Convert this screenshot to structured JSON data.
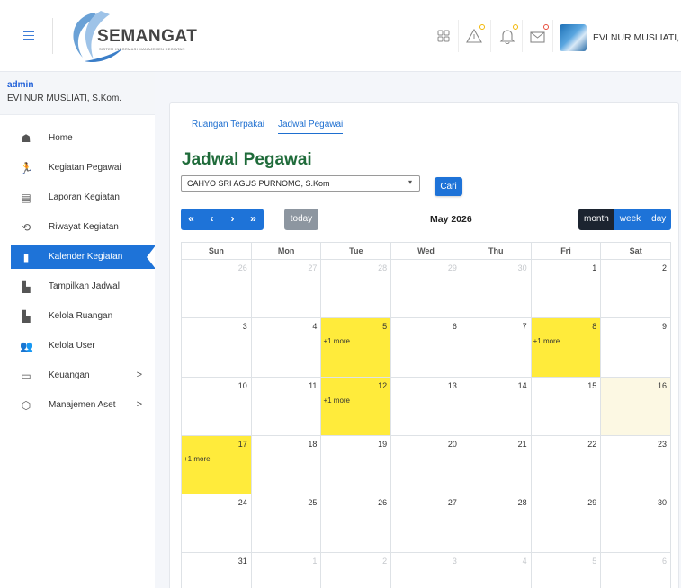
{
  "header": {
    "logo_title": "SEMANGAT",
    "logo_subtitle": "SISTEM INFORMASI MANAJEMEN KEGIATAN",
    "user_name": "EVI NUR MUSLIATI, S.Kor",
    "icons": [
      "grid-icon",
      "warning-icon",
      "bell-icon",
      "mail-icon"
    ]
  },
  "sidebar": {
    "role": "admin",
    "name": "EVI NUR MUSLIATI, S.Kom.",
    "items": [
      {
        "label": "Home",
        "icon": "house-icon"
      },
      {
        "label": "Kegiatan Pegawai",
        "icon": "person-run-icon"
      },
      {
        "label": "Laporan Kegiatan",
        "icon": "report-icon"
      },
      {
        "label": "Riwayat Kegiatan",
        "icon": "history-icon"
      },
      {
        "label": "Kalender Kegiatan",
        "icon": "calendar-book-icon",
        "active": true
      },
      {
        "label": "Tampilkan Jadwal",
        "icon": "building-icon"
      },
      {
        "label": "Kelola Ruangan",
        "icon": "building-icon"
      },
      {
        "label": "Kelola User",
        "icon": "users-icon"
      },
      {
        "label": "Keuangan",
        "icon": "table-icon",
        "chevron": ">"
      },
      {
        "label": "Manajemen Aset",
        "icon": "box-icon",
        "chevron": ">"
      }
    ]
  },
  "main": {
    "tabs": [
      {
        "label": "Ruangan Terpakai"
      },
      {
        "label": "Jadwal Pegawai",
        "active": true
      }
    ],
    "title": "Jadwal Pegawai",
    "select_value": "CAHYO SRI AGUS PURNOMO, S.Kom",
    "search_label": "Cari",
    "nav": {
      "first": "«",
      "prev": "‹",
      "next": "›",
      "last": "»"
    },
    "today_label": "today",
    "calendar_title": "May 2026",
    "views": [
      "month",
      "week",
      "day"
    ],
    "weekdays": [
      "Sun",
      "Mon",
      "Tue",
      "Wed",
      "Thu",
      "Fri",
      "Sat"
    ],
    "weeks": [
      [
        {
          "d": "26",
          "o": true
        },
        {
          "d": "27",
          "o": true
        },
        {
          "d": "28",
          "o": true
        },
        {
          "d": "29",
          "o": true
        },
        {
          "d": "30",
          "o": true
        },
        {
          "d": "1"
        },
        {
          "d": "2"
        }
      ],
      [
        {
          "d": "3"
        },
        {
          "d": "4"
        },
        {
          "d": "5",
          "ev": "+1 more"
        },
        {
          "d": "6"
        },
        {
          "d": "7"
        },
        {
          "d": "8",
          "ev": "+1 more"
        },
        {
          "d": "9"
        }
      ],
      [
        {
          "d": "10"
        },
        {
          "d": "11"
        },
        {
          "d": "12",
          "ev": "+1 more"
        },
        {
          "d": "13"
        },
        {
          "d": "14"
        },
        {
          "d": "15"
        },
        {
          "d": "16",
          "today": true
        }
      ],
      [
        {
          "d": "17",
          "ev": "+1 more"
        },
        {
          "d": "18"
        },
        {
          "d": "19"
        },
        {
          "d": "20"
        },
        {
          "d": "21"
        },
        {
          "d": "22"
        },
        {
          "d": "23"
        }
      ],
      [
        {
          "d": "24"
        },
        {
          "d": "25"
        },
        {
          "d": "26"
        },
        {
          "d": "27"
        },
        {
          "d": "28"
        },
        {
          "d": "29"
        },
        {
          "d": "30"
        }
      ],
      [
        {
          "d": "31"
        },
        {
          "d": "1",
          "o": true
        },
        {
          "d": "2",
          "o": true
        },
        {
          "d": "3",
          "o": true
        },
        {
          "d": "4",
          "o": true
        },
        {
          "d": "5",
          "o": true
        },
        {
          "d": "6",
          "o": true
        }
      ]
    ]
  },
  "colors": {
    "accent": "#1e73d8",
    "event": "#ffeb3b",
    "today": "#fcf8e3",
    "title_green": "#1f6b3a"
  }
}
